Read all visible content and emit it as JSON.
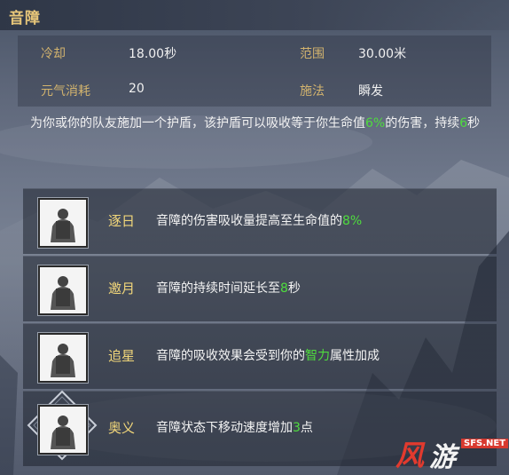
{
  "skill": {
    "name": "音障",
    "stats": {
      "cooldown_label": "冷却",
      "cooldown_value": "18.00秒",
      "range_label": "范围",
      "range_value": "30.00米",
      "cost_label": "元气消耗",
      "cost_value": "20",
      "cast_label": "施法",
      "cast_value": "瞬发"
    },
    "description": {
      "part1": "为你或你的队友施加一个护盾，该护盾可以吸收等于你生命值",
      "hl1": "6%",
      "part2": "的伤害，持续",
      "hl2": "6",
      "part3": "秒"
    }
  },
  "talents": [
    {
      "name": "逐日",
      "desc_before": "音障的伤害吸收量提高至生命值的",
      "desc_hl": "8%",
      "desc_after": "",
      "icon": "warrior-portrait-icon"
    },
    {
      "name": "邀月",
      "desc_before": "音障的持续时间延长至",
      "desc_hl": "8",
      "desc_after": "秒",
      "icon": "warrior-portrait-icon"
    },
    {
      "name": "追星",
      "desc_before": "音障的吸收效果会受到你的",
      "desc_hl": "智力",
      "desc_after": "属性加成",
      "icon": "warrior-portrait-icon"
    },
    {
      "name": "奥义",
      "desc_before": "音障状态下移动速度增加",
      "desc_hl": "3",
      "desc_after": "点",
      "icon": "warrior-portrait-icon"
    }
  ],
  "watermark": {
    "text1": "风",
    "text2": "游",
    "text3": "SFS.NET"
  },
  "colors": {
    "title": "#e8c77a",
    "label": "#d2b36e",
    "highlight": "#4fdc3e",
    "talent_name": "#f1d67a"
  }
}
